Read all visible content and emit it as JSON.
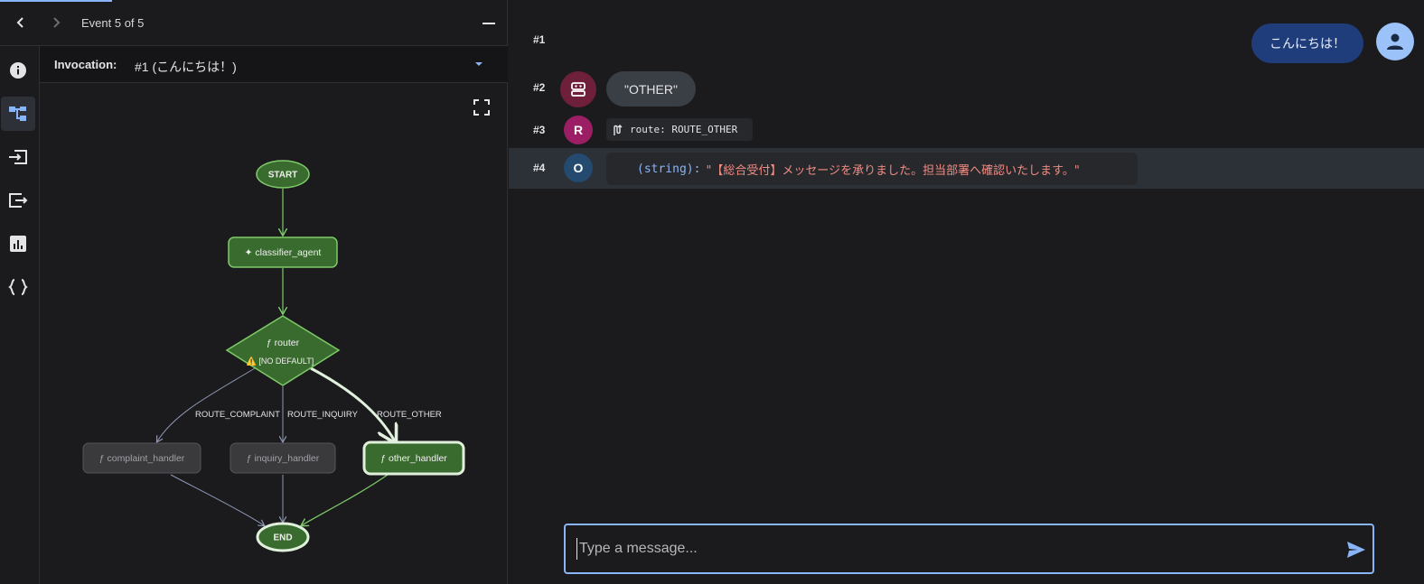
{
  "header": {
    "event_label": "Event 5 of 5"
  },
  "side_rail": {
    "items": [
      "info-icon",
      "graph-icon",
      "input-icon",
      "output-icon",
      "chart-icon",
      "json-icon"
    ],
    "active": "graph-icon"
  },
  "invocation": {
    "label": "Invocation:",
    "value": "#1 (こんにちは！)"
  },
  "graph": {
    "nodes": {
      "start": "START",
      "classifier": "✦ classifier_agent",
      "router": "ƒ router",
      "router_warning": "⚠️ [NO DEFAULT]",
      "complaint": "ƒ complaint_handler",
      "inquiry": "ƒ inquiry_handler",
      "other": "ƒ other_handler",
      "end": "END"
    },
    "edges": {
      "complaint": "ROUTE_COMPLAINT",
      "inquiry": "ROUTE_INQUIRY",
      "other": "ROUTE_OTHER"
    },
    "colors": {
      "active_fill": "#3a6b2e",
      "active_stroke": "#7ecb6a",
      "inactive_fill": "#3a3a3d",
      "inactive_edge": "#8c97b4"
    }
  },
  "events": {
    "row1": {
      "num": "#1",
      "user_message": "こんにちは！"
    },
    "row2": {
      "num": "#2",
      "text": "\"OTHER\""
    },
    "row3": {
      "num": "#3",
      "avatar": "R",
      "route": "route: ROUTE_OTHER"
    },
    "row4": {
      "num": "#4",
      "avatar": "O",
      "key": "(string)",
      "colon": ":",
      "value": "\"【総合受付】メッセージを承りました。担当部署へ確認いたします。\""
    }
  },
  "composer": {
    "placeholder": "Type a message..."
  }
}
